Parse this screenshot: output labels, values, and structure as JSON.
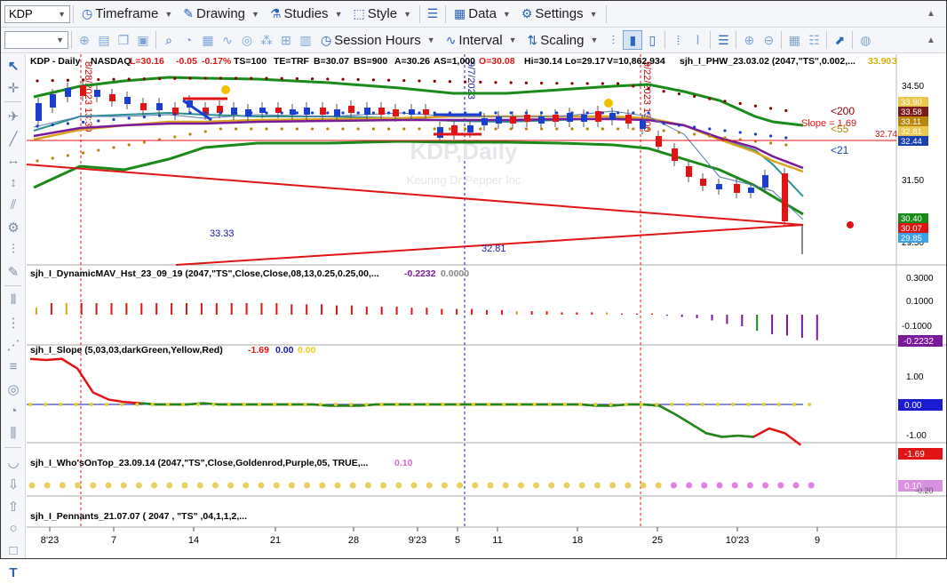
{
  "toolbar1": {
    "symbol": "KDP",
    "items": [
      "Timeframe",
      "Drawing",
      "Studies",
      "Style",
      "Data",
      "Settings"
    ]
  },
  "toolbar2": {
    "items": [
      "Session Hours",
      "Interval",
      "Scaling"
    ]
  },
  "header": {
    "symbol": "KDP - Daily",
    "exchange": "NASDAQ",
    "last": "L=30.16",
    "change": "-0.05",
    "change_pct": "-0.17%",
    "ts": "TS=100",
    "te": "TE=TRF",
    "bid": "B=30.07",
    "bid_size": "BS=900",
    "ask": "A=30.26",
    "ask_size": "AS=1,000",
    "open": "O=30.08",
    "high": "Hi=30.14",
    "low": "Lo=29.17",
    "volume": "V=10,862,934",
    "study": "sjh_I_PHW_23.03.02 (2047,\"TS\",0.002,...",
    "study_val": "33.90",
    "study_val2": "3"
  },
  "watermark": {
    "title": "KDP,Daily",
    "subtitle": "Keuring Dr Pepper Inc"
  },
  "annotations": {
    "pennant_hi": "33.33",
    "pennant_lo": "32.81",
    "slope": "Slope = 1.69",
    "lt200": "<200",
    "lt55": "<55",
    "lt21": "<21",
    "hline": "32.74"
  },
  "price_axis": {
    "ticks": [
      "34.50",
      "31.50",
      "29.50"
    ],
    "badges": [
      {
        "text": "33.90",
        "color": "#e8c84a"
      },
      {
        "text": "33.58",
        "color": "#7a1a1a"
      },
      {
        "text": "33.11",
        "color": "#b8860b"
      },
      {
        "text": "32.81",
        "color": "#e8c84a"
      },
      {
        "text": "32.44",
        "color": "#1a3fb0"
      },
      {
        "text": "30.40",
        "color": "#1a8a1a"
      },
      {
        "text": "30.07",
        "color": "#e01414"
      },
      {
        "text": "29.85",
        "color": "#3aa0e8"
      }
    ]
  },
  "vertical_date_labels": [
    "8/28/2023 13:30",
    "9/7/2023",
    "9/22/2023 13:00"
  ],
  "panels": {
    "mav": {
      "title": "sjh_I_DynamicMAV_Hst_23_09_19 (2047,\"TS\",Close,Close,08,13,0.25,0.25,00,...",
      "v1": "-0.2232",
      "v2": "0.0000",
      "ticks": [
        "0.3000",
        "0.1000",
        "-0.1000"
      ],
      "badge": "-0.2232",
      "values": [
        0.06,
        0.1,
        0.1,
        0.1,
        0.1,
        0.1,
        0.1,
        0.1,
        0.1,
        0.1,
        0.1,
        0.1,
        0.1,
        0.1,
        0.1,
        0.1,
        0.1,
        0.09,
        0.09,
        0.09,
        0.08,
        0.08,
        0.07,
        0.07,
        0.07,
        0.06,
        0.06,
        0.05,
        0.05,
        0.05,
        0.04,
        0.04,
        0.03,
        0.03,
        0.03,
        0.02,
        0.02,
        0.02,
        0.02,
        0.01,
        0.01,
        0.01,
        -0.01,
        -0.02,
        -0.03,
        -0.05,
        -0.08,
        -0.1,
        -0.14,
        -0.17,
        -0.18,
        -0.2,
        -0.22
      ]
    },
    "slope": {
      "title": "sjh_I_Slope (5,03,03,darkGreen,Yellow,Red)",
      "v1": "-1.69",
      "v2": "0.00",
      "v3": "0.00",
      "ticks": [
        "1.00",
        "-1.00"
      ],
      "badge_zero": "0.00",
      "badge": "-1.69",
      "values": [
        1.9,
        1.85,
        1.9,
        1.5,
        0.5,
        0.2,
        0.1,
        0.05,
        0,
        0,
        0,
        0.05,
        0,
        0,
        0,
        0,
        0,
        0,
        0,
        -0.05,
        -0.05,
        -0.05,
        0,
        0,
        0,
        0,
        0,
        0,
        0,
        0,
        0,
        0,
        0,
        0,
        0,
        0,
        -0.05,
        -0.05,
        0,
        0,
        -0.05,
        -0.4,
        -0.8,
        -1.2,
        -1.35,
        -1.3,
        -1.35,
        -1.0,
        -1.2,
        -1.69
      ]
    },
    "whos": {
      "title": "sjh_I_Who'sOnTop_23.09.14 (2047,\"TS\",Close,Goldenrod,Purple,05, TRUE,...",
      "v1": "0.10",
      "badge": "0.10",
      "tick": "-0.20"
    },
    "pennants": {
      "title": "sjh_I_Pennants_21.07.07 ( 2047 , \"TS\" ,04,1,1,2,..."
    }
  },
  "x_axis": [
    "8'23",
    "7",
    "14",
    "21",
    "28",
    "9'23",
    "5",
    "11",
    "18",
    "25",
    "10'23",
    "9"
  ],
  "colors": {
    "up": "#1a3fd0",
    "down": "#e01414",
    "green_band": "#1a8a1a",
    "teal": "#2a9090",
    "goldenrod": "#d9a520",
    "purple": "#7a1a9a"
  }
}
